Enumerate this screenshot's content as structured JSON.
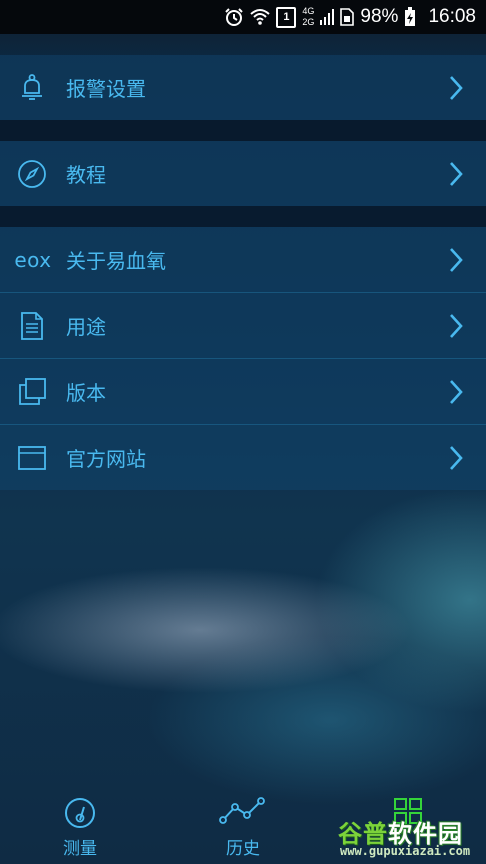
{
  "status_bar": {
    "network_4g": "4G",
    "network_2g": "2G",
    "sim_slot": "1",
    "battery": "98%",
    "time": "16:08"
  },
  "menu": {
    "items": [
      {
        "label": "报警设置",
        "icon": "bell-icon"
      },
      {
        "label": "教程",
        "icon": "compass-icon"
      },
      {
        "label": "关于易血氧",
        "icon": "eox-logo",
        "icon_text": "eox"
      },
      {
        "label": "用途",
        "icon": "document-icon"
      },
      {
        "label": "版本",
        "icon": "copy-icon"
      },
      {
        "label": "官方网站",
        "icon": "browser-window-icon"
      }
    ]
  },
  "tabs": [
    {
      "label": "测量",
      "icon": "gauge-icon"
    },
    {
      "label": "历史",
      "icon": "line-chart-icon"
    },
    {
      "label": "",
      "icon": "grid-icon",
      "active": true
    }
  ],
  "watermark": {
    "title_part1": "谷普",
    "title_part2": "软件园",
    "url": "www.gupuxiazai.com"
  },
  "colors": {
    "accent": "#49b9ef",
    "active_tab": "#35d43a"
  }
}
